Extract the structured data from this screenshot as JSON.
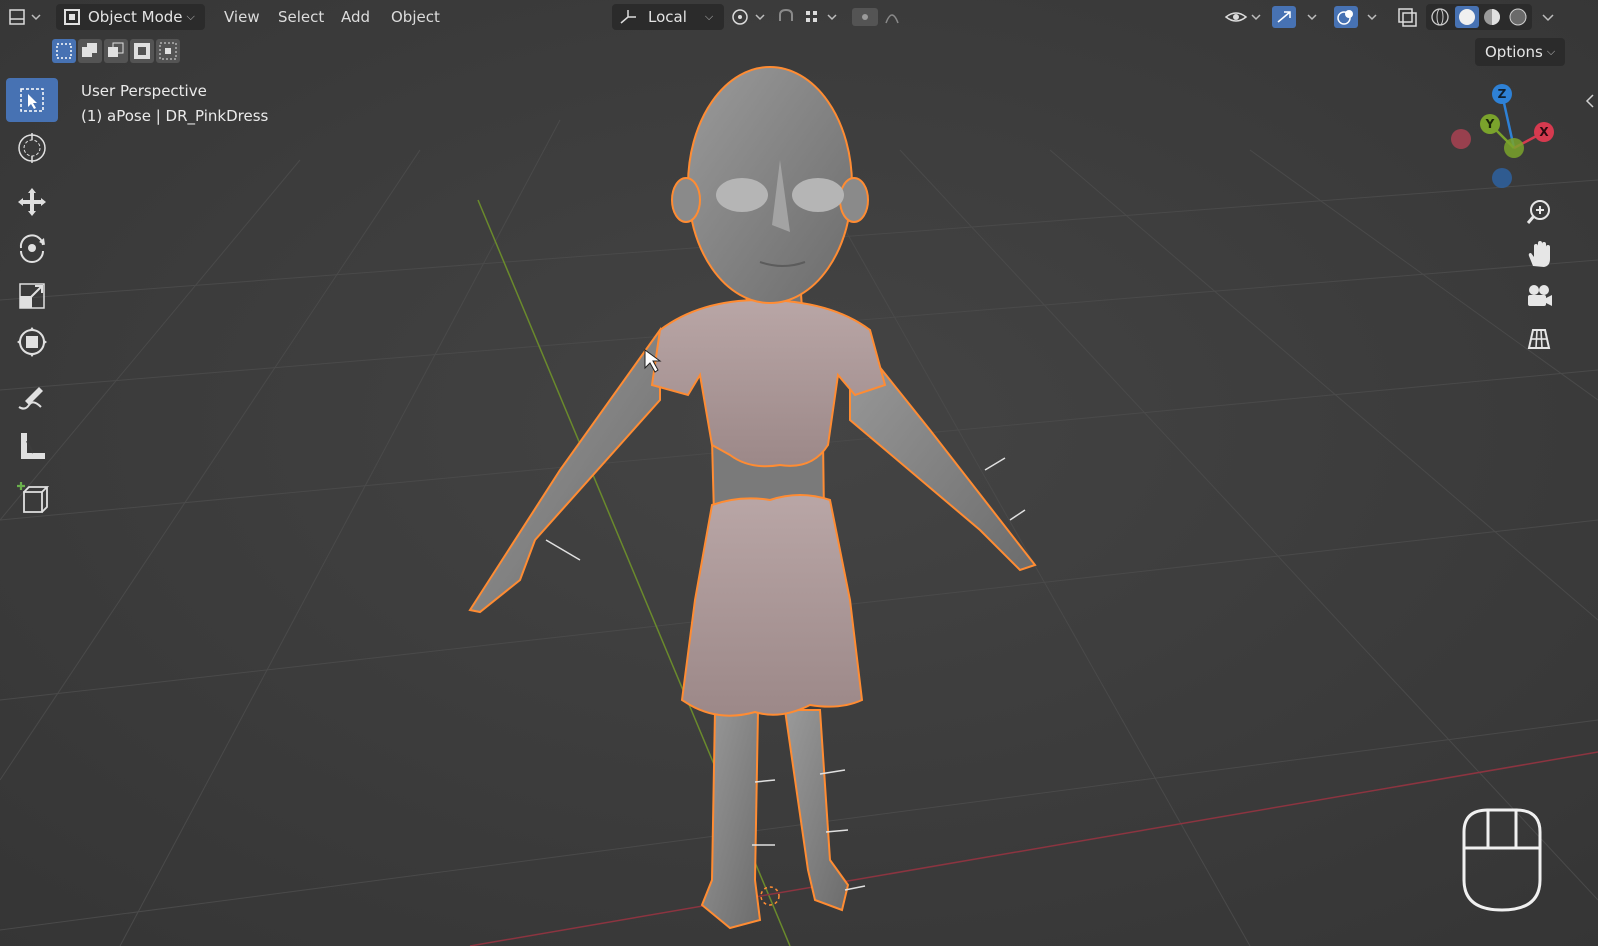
{
  "header": {
    "editor_type_icon": "editor-type-icon",
    "mode_label": "Object Mode",
    "menu": [
      "View",
      "Select",
      "Add",
      "Object"
    ],
    "transform_orientation": "Local",
    "options_label": "Options"
  },
  "viewport": {
    "view_name": "User Perspective",
    "object_info": "(1) aPose | DR_PinkDress"
  },
  "gizmo": {
    "z": "Z",
    "y": "Y",
    "x": "X"
  },
  "colors": {
    "background": "#3d3d3d",
    "active_tool": "#4772b3",
    "selection_outline": "#ff8c33",
    "axis_x": "#d63a4f",
    "axis_y": "#7aa32c",
    "axis_z": "#2e81d6"
  },
  "tools": [
    "select-box-icon",
    "cursor-icon",
    "move-icon",
    "rotate-icon",
    "scale-icon",
    "transform-icon",
    "annotate-icon",
    "measure-icon",
    "add-cube-icon"
  ],
  "nav_buttons": [
    "zoom-icon",
    "pan-hand-icon",
    "camera-view-icon",
    "ortho-grid-icon"
  ]
}
